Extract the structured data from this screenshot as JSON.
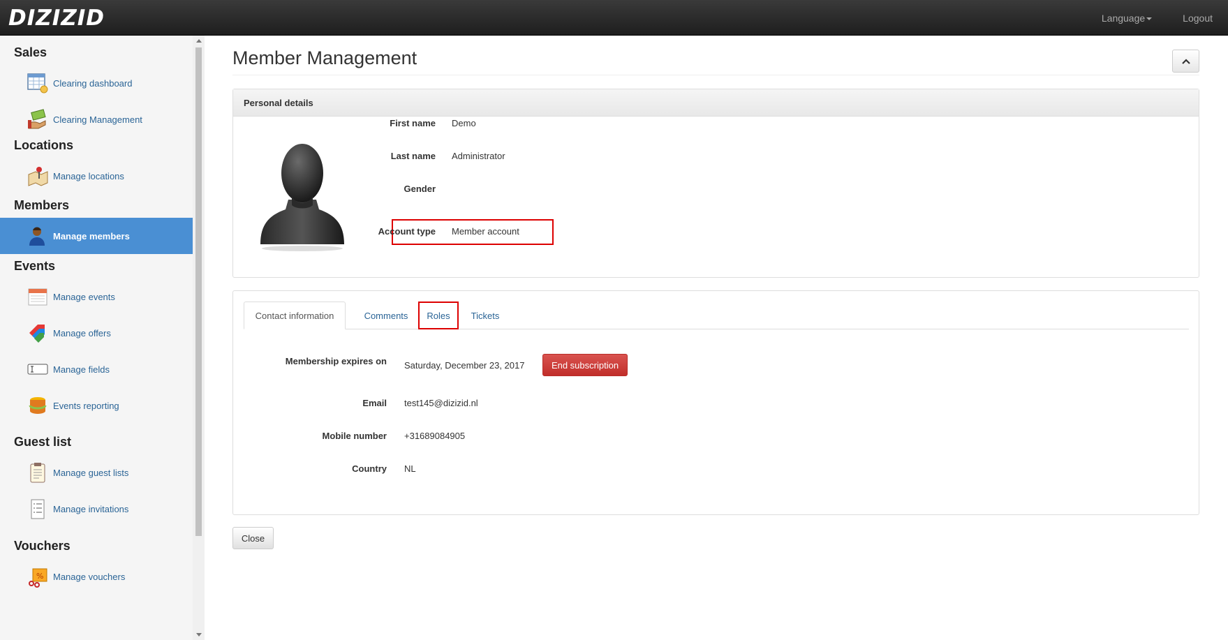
{
  "navbar": {
    "brand": "DIZIZID",
    "language_label": "Language",
    "logout_label": "Logout"
  },
  "sidebar": {
    "sections": [
      {
        "title": "Sales",
        "items": [
          {
            "label": "Clearing dashboard",
            "icon": "calendar-spreadsheet-icon"
          },
          {
            "label": "Clearing Management",
            "icon": "money-hand-icon"
          }
        ]
      },
      {
        "title": "Locations",
        "items": [
          {
            "label": "Manage locations",
            "icon": "map-pin-icon"
          }
        ]
      },
      {
        "title": "Members",
        "items": [
          {
            "label": "Manage members",
            "icon": "user-icon",
            "active": true
          }
        ]
      },
      {
        "title": "Events",
        "items": [
          {
            "label": "Manage events",
            "icon": "calendar-icon"
          },
          {
            "label": "Manage offers",
            "icon": "tags-icon"
          },
          {
            "label": "Manage fields",
            "icon": "text-field-icon"
          },
          {
            "label": "Events reporting",
            "icon": "database-icon"
          }
        ]
      },
      {
        "title": "Guest list",
        "items": [
          {
            "label": "Manage guest lists",
            "icon": "clipboard-icon"
          },
          {
            "label": "Manage invitations",
            "icon": "checklist-icon"
          }
        ]
      },
      {
        "title": "Vouchers",
        "items": [
          {
            "label": "Manage vouchers",
            "icon": "voucher-icon"
          }
        ]
      }
    ]
  },
  "main": {
    "title": "Member Management",
    "personal": {
      "heading": "Personal details",
      "first_name_label": "First name",
      "first_name": "Demo",
      "last_name_label": "Last name",
      "last_name": "Administrator",
      "gender_label": "Gender",
      "gender": "",
      "account_type_label": "Account type",
      "account_type": "Member account"
    },
    "tabs": [
      "Contact information",
      "Comments",
      "Roles",
      "Tickets"
    ],
    "contact": {
      "expires_label": "Membership expires on",
      "expires": "Saturday, December 23, 2017",
      "end_subscription": "End subscription",
      "email_label": "Email",
      "email": "test145@dizizid.nl",
      "mobile_label": "Mobile number",
      "mobile": "+31689084905",
      "country_label": "Country",
      "country": "NL"
    },
    "close_label": "Close"
  },
  "colors": {
    "navbar": "#222222",
    "active_item": "#4a8fd3",
    "link": "#2a6496",
    "danger": "#d9534f",
    "highlight": "#dd0000"
  }
}
